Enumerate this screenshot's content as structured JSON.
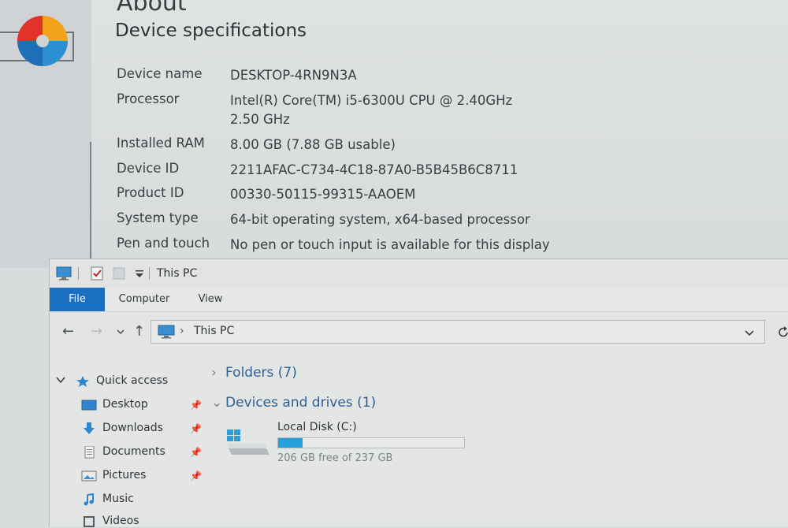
{
  "settings": {
    "title": "About",
    "heading": "Device specifications",
    "specs": [
      {
        "label": "Device name",
        "value": "DESKTOP-4RN9N3A"
      },
      {
        "label": "Processor",
        "value": "Intel(R) Core(TM) i5-6300U CPU @ 2.40GHz   2.50 GHz"
      },
      {
        "label": "Installed RAM",
        "value": "8.00 GB (7.88 GB usable)"
      },
      {
        "label": "Device ID",
        "value": "2211AFAC-C734-4C18-87A0-B5B45B6C8711"
      },
      {
        "label": "Product ID",
        "value": "00330-50115-99315-AAOEM"
      },
      {
        "label": "System type",
        "value": "64-bit operating system, x64-based processor"
      },
      {
        "label": "Pen and touch",
        "value": "No pen or touch input is available for this display"
      }
    ]
  },
  "explorer": {
    "window_title": "This PC",
    "ribbon_tabs": [
      "File",
      "Computer",
      "View"
    ],
    "active_tab": "File",
    "address": {
      "path": "This PC",
      "separator": "›"
    },
    "nav": {
      "quick_access": "Quick access",
      "items": [
        {
          "label": "Desktop",
          "icon": "desktop-icon",
          "pinned": true
        },
        {
          "label": "Downloads",
          "icon": "downloads-icon",
          "pinned": true
        },
        {
          "label": "Documents",
          "icon": "documents-icon",
          "pinned": true
        },
        {
          "label": "Pictures",
          "icon": "pictures-icon",
          "pinned": true
        },
        {
          "label": "Music",
          "icon": "music-icon",
          "pinned": false
        },
        {
          "label": "Videos",
          "icon": "videos-icon",
          "pinned": false
        }
      ]
    },
    "groups": {
      "folders": "Folders (7)",
      "devices": "Devices and drives (1)"
    },
    "drive": {
      "name": "Local Disk (C:)",
      "free_text": "206 GB free of 237 GB",
      "used_fraction": 0.131
    }
  },
  "colors": {
    "accent": "#1b6fc0",
    "drive_bar": "#26a0da",
    "group_header": "#2e5f93"
  }
}
